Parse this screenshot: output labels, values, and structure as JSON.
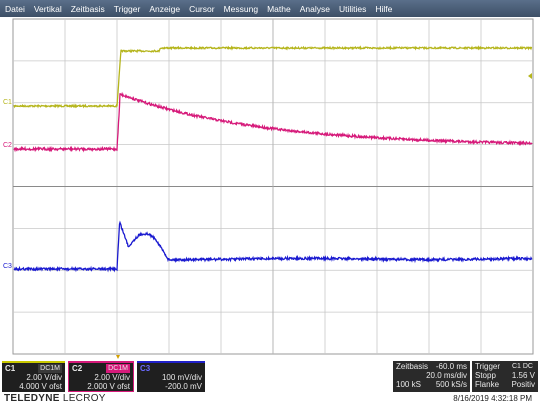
{
  "menu": [
    "Datei",
    "Vertikal",
    "Zeitbasis",
    "Trigger",
    "Anzeige",
    "Cursor",
    "Messung",
    "Mathe",
    "Analyse",
    "Utilities",
    "Hilfe"
  ],
  "colors": {
    "c1": "#b5b51c",
    "c2": "#d61a7a",
    "c3": "#1a1ad0",
    "grid": "#c8c8c8"
  },
  "channel_markers": {
    "c1": "C1",
    "c2": "C2",
    "c3": "C3"
  },
  "channels": [
    {
      "tag": "C1",
      "mode": "DC1M",
      "vdiv": "2.00 V/div",
      "offset": "4.000 V ofst"
    },
    {
      "tag": "C2",
      "mode": "DC1M",
      "vdiv": "2.00 V/div",
      "offset": "2.000 V ofst"
    },
    {
      "tag": "C3",
      "mode": "",
      "vdiv": "100 mV/div",
      "offset": "-200.0 mV"
    }
  ],
  "timebase": {
    "label": "Zeitbasis",
    "delay": "-60.0 ms",
    "tdiv": "20.0 ms/div",
    "samples": "100 kS",
    "rate": "500 kS/s"
  },
  "trigger": {
    "label": "Trigger",
    "source": "C1 DC",
    "state": "Stopp",
    "level": "1.56 V",
    "type": "Flanke",
    "slope": "Positiv"
  },
  "brand": {
    "main": "TELEDYNE",
    "sub": "LECROY"
  },
  "timestamp": "8/16/2019 4:32:18 PM"
}
